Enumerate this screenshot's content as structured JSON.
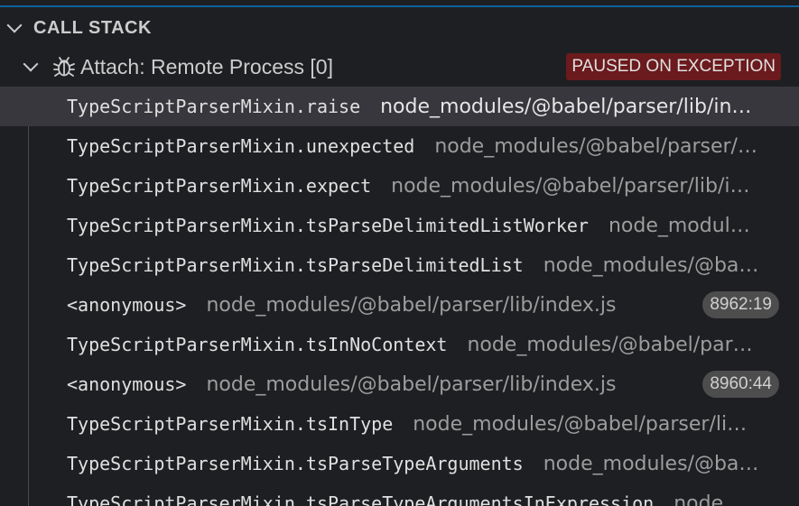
{
  "section": {
    "title": "CALL STACK"
  },
  "session": {
    "label": "Attach: Remote Process [0]",
    "status": "PAUSED ON EXCEPTION",
    "icon": "bug-icon"
  },
  "colors": {
    "accent": "#0e639c",
    "status_badge_bg": "#6b1a1d",
    "selected_row_bg": "#37373d"
  },
  "frames": [
    {
      "name": "TypeScriptParserMixin.raise",
      "path": "node_modules/@babel/parser/lib/index.js",
      "selected": true
    },
    {
      "name": "TypeScriptParserMixin.unexpected",
      "path": "node_modules/@babel/parser/lib/index.js"
    },
    {
      "name": "TypeScriptParserMixin.expect",
      "path": "node_modules/@babel/parser/lib/index.js"
    },
    {
      "name": "TypeScriptParserMixin.tsParseDelimitedListWorker",
      "path": "node_modules/@babel/parser/lib/index.js"
    },
    {
      "name": "TypeScriptParserMixin.tsParseDelimitedList",
      "path": "node_modules/@babel/parser/lib/index.js"
    },
    {
      "name": "<anonymous>",
      "path": "node_modules/@babel/parser/lib/index.js",
      "badge": "8962:19"
    },
    {
      "name": "TypeScriptParserMixin.tsInNoContext",
      "path": "node_modules/@babel/parser/lib/index.js"
    },
    {
      "name": "<anonymous>",
      "path": "node_modules/@babel/parser/lib/index.js",
      "badge": "8960:44"
    },
    {
      "name": "TypeScriptParserMixin.tsInType",
      "path": "node_modules/@babel/parser/lib/index.js"
    },
    {
      "name": "TypeScriptParserMixin.tsParseTypeArguments",
      "path": "node_modules/@babel/parser/lib/index.js"
    },
    {
      "name": "TypeScriptParserMixin.tsParseTypeArgumentsInExpression",
      "path": "node_modules/@babel/parser/lib/index.js"
    }
  ]
}
